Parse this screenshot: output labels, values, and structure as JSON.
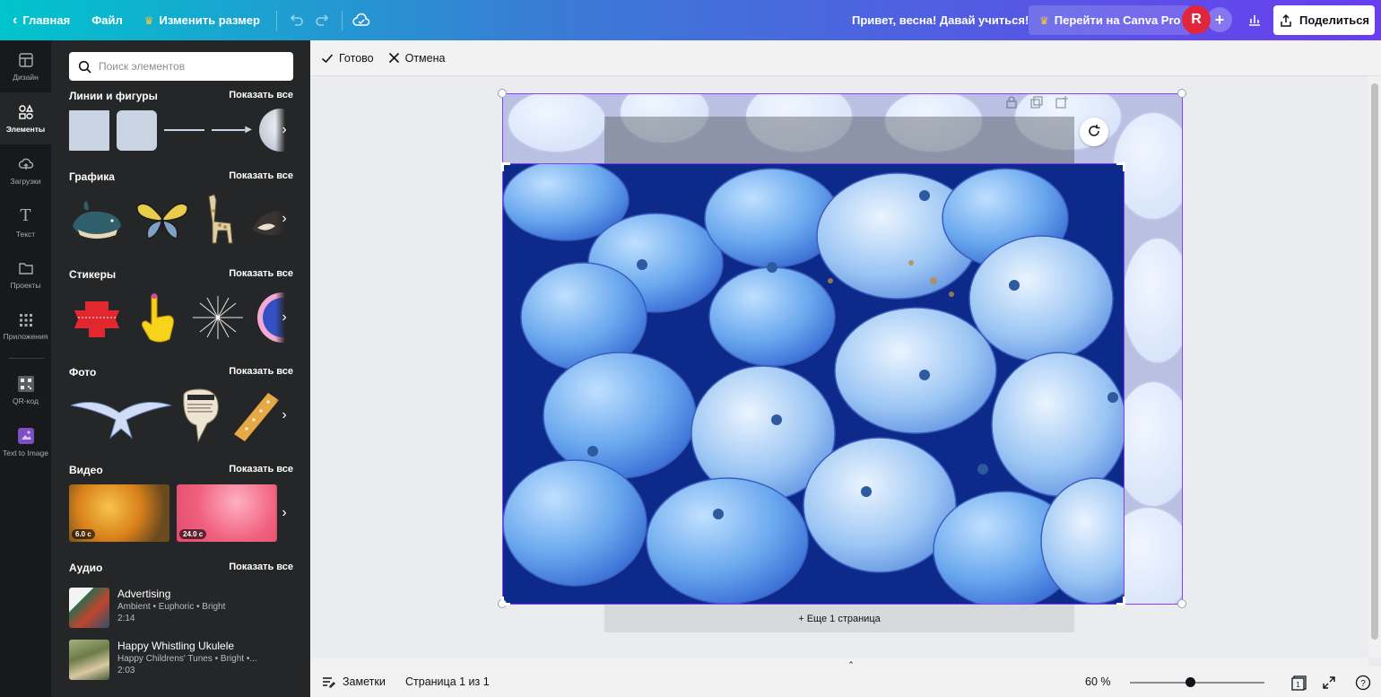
{
  "topbar": {
    "home_label": "Главная",
    "file_label": "Файл",
    "resize_label": "Изменить размер",
    "greeting": "Привет, весна! Давай учиться!",
    "pro_label": "Перейти на Canva Pro",
    "avatar_letter": "R",
    "plus_label": "+",
    "share_label": "Поделиться"
  },
  "rail": {
    "items": [
      {
        "label": "Дизайн",
        "icon": "layout-icon"
      },
      {
        "label": "Элементы",
        "icon": "shapes-icon"
      },
      {
        "label": "Загрузки",
        "icon": "cloud-upload-icon"
      },
      {
        "label": "Текст",
        "icon": "text-icon"
      },
      {
        "label": "Проекты",
        "icon": "folder-icon"
      },
      {
        "label": "Приложения",
        "icon": "apps-grid-icon"
      },
      {
        "label": "QR-код",
        "icon": "qr-code-icon"
      },
      {
        "label": "Text to Image",
        "icon": "text-to-image-icon"
      }
    ]
  },
  "panel": {
    "search_placeholder": "Поиск элементов",
    "show_all": "Показать все",
    "sections": {
      "lines": "Линии и фигуры",
      "graphics": "Графика",
      "stickers": "Стикеры",
      "photos": "Фото",
      "videos": "Видео",
      "audio": "Аудио"
    },
    "videos": [
      {
        "duration": "6.0 с"
      },
      {
        "duration": "24.0 с"
      }
    ],
    "audio": [
      {
        "title": "Advertising",
        "meta": "Ambient • Euphoric • Bright",
        "duration": "2:14"
      },
      {
        "title": "Happy Whistling Ukulele",
        "meta": "Happy Childrens' Tunes • Bright •...",
        "duration": "2:03"
      }
    ]
  },
  "toolbar": {
    "done_label": "Готово",
    "cancel_label": "Отмена"
  },
  "canvas": {
    "more_pages": "+ Еще 1 страница"
  },
  "status": {
    "notes_label": "Заметки",
    "page_info": "Страница 1 из 1",
    "zoom": "60 %",
    "zoom_level": 0.45,
    "page_count_badge": "1"
  },
  "colors": {
    "accent": "#8b3dff",
    "avatar": "#e0263c",
    "rail_bg": "#18191b",
    "panel_bg": "#252627"
  }
}
